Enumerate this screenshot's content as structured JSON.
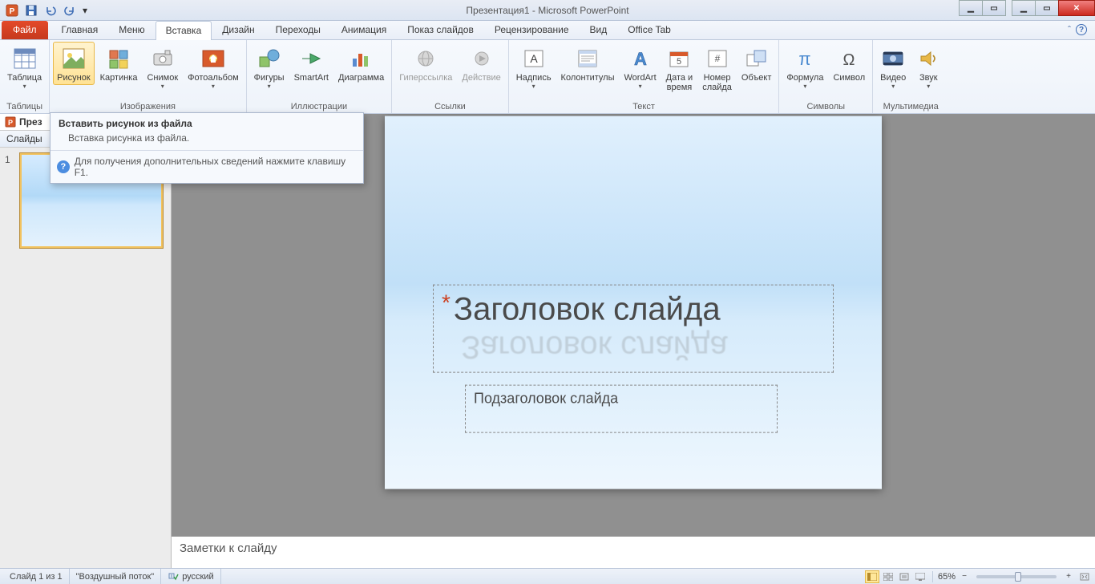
{
  "title": "Презентация1 - Microsoft PowerPoint",
  "tabs": {
    "file": "Файл",
    "home": "Главная",
    "menu": "Меню",
    "insert": "Вставка",
    "design": "Дизайн",
    "transitions": "Переходы",
    "anim": "Анимация",
    "show": "Показ слайдов",
    "review": "Рецензирование",
    "view": "Вид",
    "office": "Office Tab"
  },
  "ribbon": {
    "groups": {
      "tables": {
        "label": "Таблицы"
      },
      "images": {
        "label": "Изображения"
      },
      "illustrations": {
        "label": "Иллюстрации"
      },
      "links": {
        "label": "Ссылки"
      },
      "text": {
        "label": "Текст"
      },
      "symbols": {
        "label": "Символы"
      },
      "media": {
        "label": "Мультимедиа"
      }
    },
    "btns": {
      "table": "Таблица",
      "picture": "Рисунок",
      "clipart": "Картинка",
      "screenshot": "Снимок",
      "album": "Фотоальбом",
      "shapes": "Фигуры",
      "smartart": "SmartArt",
      "chart": "Диаграмма",
      "hyperlink": "Гиперссылка",
      "action": "Действие",
      "textbox": "Надпись",
      "headerfooter": "Колонтитулы",
      "wordart": "WordArt",
      "datetime": "Дата и\nвремя",
      "slidenum": "Номер\nслайда",
      "object": "Объект",
      "equation": "Формула",
      "symbol": "Символ",
      "video": "Видео",
      "audio": "Звук"
    }
  },
  "sidepanel": {
    "docname": "През",
    "tab_slides": "Слайды",
    "thumb_num": "1"
  },
  "slide": {
    "title": "Заголовок слайда",
    "subtitle": "Подзаголовок слайда"
  },
  "notes": {
    "placeholder": "Заметки к слайду"
  },
  "tooltip": {
    "title": "Вставить рисунок из файла",
    "body": "Вставка рисунка из файла.",
    "help": "Для получения дополнительных сведений нажмите клавишу F1."
  },
  "status": {
    "slide": "Слайд 1 из 1",
    "theme": "\"Воздушный поток\"",
    "lang": "русский",
    "zoom": "65%"
  }
}
